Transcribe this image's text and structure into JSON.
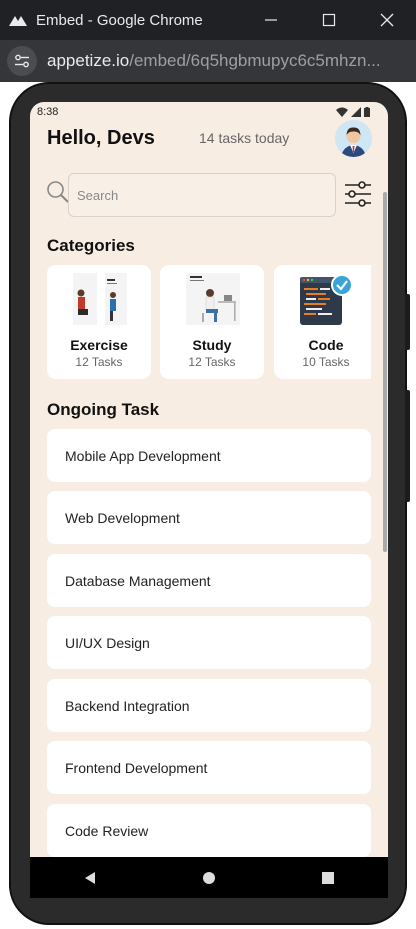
{
  "window": {
    "title": "Embed - Google Chrome",
    "url_host": "appetize.io",
    "url_path": "/embed/6q5hgbmupyc6c5mhzn..."
  },
  "status": {
    "time": "8:38"
  },
  "header": {
    "greeting": "Hello, Devs",
    "tasks_today": "14 tasks today"
  },
  "search": {
    "placeholder": "Search"
  },
  "categories": {
    "title": "Categories",
    "items": [
      {
        "name": "Exercise",
        "count": "12 Tasks",
        "icon": "exercise-illustration"
      },
      {
        "name": "Study",
        "count": "12 Tasks",
        "icon": "study-illustration"
      },
      {
        "name": "Code",
        "count": "10 Tasks",
        "icon": "code-illustration"
      }
    ]
  },
  "ongoing": {
    "title": "Ongoing Task",
    "items": [
      {
        "label": "Mobile App Development"
      },
      {
        "label": "Web Development"
      },
      {
        "label": "Database Management"
      },
      {
        "label": "UI/UX Design"
      },
      {
        "label": "Backend Integration"
      },
      {
        "label": "Frontend Development"
      },
      {
        "label": "Code Review"
      }
    ]
  },
  "colors": {
    "background": "#f7ede3",
    "card": "#ffffff",
    "accent": "#3aa3d8"
  }
}
